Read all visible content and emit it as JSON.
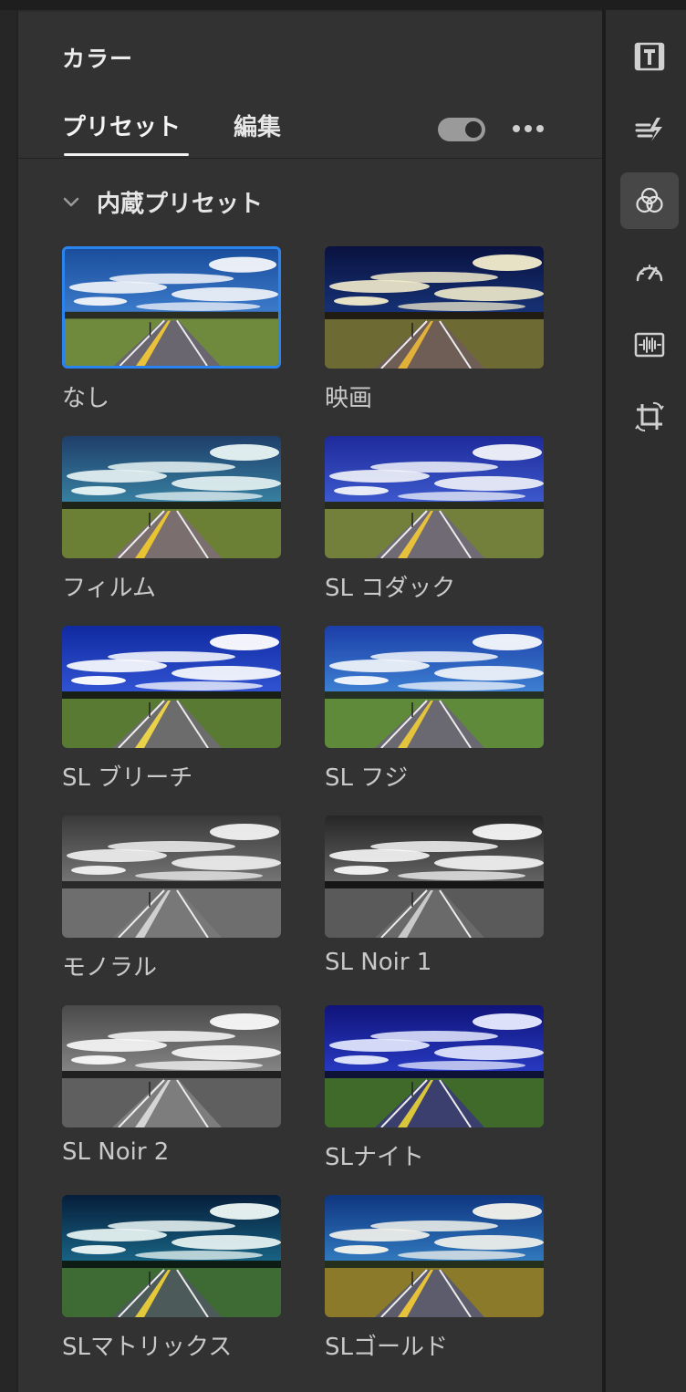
{
  "panel": {
    "title": "カラー",
    "tabs": [
      {
        "label": "プリセット",
        "active": true
      },
      {
        "label": "編集",
        "active": false
      }
    ],
    "toggle_on": true,
    "more_icon": "more-dots-icon"
  },
  "section": {
    "label": "内蔵プリセット",
    "icon": "chevron-down-icon"
  },
  "presets": [
    {
      "label": "なし",
      "selected": true,
      "style": "none"
    },
    {
      "label": "映画",
      "selected": false,
      "style": "cinema"
    },
    {
      "label": "フィルム",
      "selected": false,
      "style": "film"
    },
    {
      "label": "SL コダック",
      "selected": false,
      "style": "kodak"
    },
    {
      "label": "SL ブリーチ",
      "selected": false,
      "style": "bleach"
    },
    {
      "label": "SL フジ",
      "selected": false,
      "style": "fuji"
    },
    {
      "label": "モノラル",
      "selected": false,
      "style": "mono"
    },
    {
      "label": "SL Noir 1",
      "selected": false,
      "style": "noir1"
    },
    {
      "label": "SL Noir 2",
      "selected": false,
      "style": "noir2"
    },
    {
      "label": "SLナイト",
      "selected": false,
      "style": "night"
    },
    {
      "label": "SLマトリックス",
      "selected": false,
      "style": "matrix"
    },
    {
      "label": "SLゴールド",
      "selected": false,
      "style": "gold"
    }
  ],
  "rail": {
    "icons": [
      "title-text-icon",
      "transition-icon",
      "color-circles-icon",
      "speedometer-icon",
      "audio-waveform-icon",
      "crop-rotate-icon"
    ],
    "active": "color-circles-icon"
  },
  "colors": {
    "accent": "#2a84f0",
    "panel_bg": "#323232",
    "rail_bg": "#2e2e2e"
  }
}
